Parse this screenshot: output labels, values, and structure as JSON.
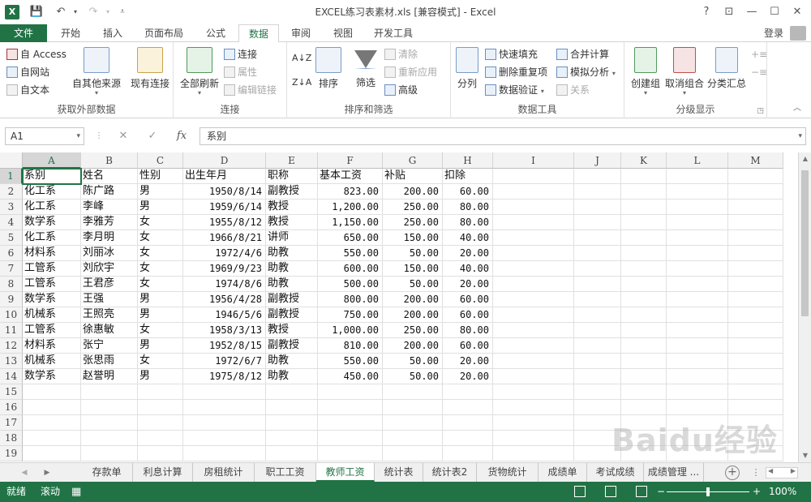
{
  "title_bar": {
    "title": "EXCEL练习表素材.xls  [兼容模式] - Excel",
    "logo": "X",
    "help": "?",
    "restore_ribbon": "⊡",
    "minimize": "—",
    "maximize": "☐",
    "close": "✕"
  },
  "tabs": {
    "items": [
      "文件",
      "开始",
      "插入",
      "页面布局",
      "公式",
      "数据",
      "审阅",
      "视图",
      "开发工具"
    ],
    "active": "数据",
    "login": "登录"
  },
  "ribbon": {
    "groups": {
      "external": "获取外部数据",
      "connections": "连接",
      "sortfilter": "排序和筛选",
      "datatools": "数据工具",
      "outline": "分级显示"
    },
    "buttons": {
      "from_access": "自 Access",
      "from_web": "自网站",
      "from_text": "自文本",
      "from_other": "自其他来源",
      "existing": "现有连接",
      "refresh_all": "全部刷新",
      "connections": "连接",
      "properties": "属性",
      "edit_links": "编辑链接",
      "sort": "排序",
      "filter": "筛选",
      "clear": "清除",
      "reapply": "重新应用",
      "advanced": "高级",
      "text_to_columns": "分列",
      "flash_fill": "快速填充",
      "remove_dup": "删除重复项",
      "validation": "数据验证",
      "consolidate": "合并计算",
      "whatif": "模拟分析",
      "relations": "关系",
      "group": "创建组",
      "ungroup": "取消组合",
      "subtotal": "分类汇总"
    }
  },
  "formula_bar": {
    "name_box": "A1",
    "cancel": "✕",
    "enter": "✓",
    "fx": "fx",
    "value": "系别"
  },
  "grid": {
    "columns": [
      "A",
      "B",
      "C",
      "D",
      "E",
      "F",
      "G",
      "H",
      "I",
      "J",
      "K",
      "L",
      "M"
    ],
    "row_numbers": [
      "1",
      "2",
      "3",
      "4",
      "5",
      "6",
      "7",
      "8",
      "9",
      "10",
      "11",
      "12",
      "13",
      "14",
      "15",
      "16",
      "17",
      "18",
      "19"
    ],
    "rows": [
      [
        "系别",
        "姓名",
        "性别",
        "出生年月",
        "职称",
        "基本工资",
        "补贴",
        "扣除"
      ],
      [
        "化工系",
        "陈广路",
        "男",
        "1950/8/14",
        "副教授",
        "823.00",
        "200.00",
        "60.00"
      ],
      [
        "化工系",
        "李峰",
        "男",
        "1959/6/14",
        "教授",
        "1,200.00",
        "250.00",
        "80.00"
      ],
      [
        "数学系",
        "李雅芳",
        "女",
        "1955/8/12",
        "教授",
        "1,150.00",
        "250.00",
        "80.00"
      ],
      [
        "化工系",
        "李月明",
        "女",
        "1966/8/21",
        "讲师",
        "650.00",
        "150.00",
        "40.00"
      ],
      [
        "材料系",
        "刘丽冰",
        "女",
        "1972/4/6",
        "助教",
        "550.00",
        "50.00",
        "20.00"
      ],
      [
        "工管系",
        "刘欣宇",
        "女",
        "1969/9/23",
        "助教",
        "600.00",
        "150.00",
        "40.00"
      ],
      [
        "工管系",
        "王君彦",
        "女",
        "1974/8/6",
        "助教",
        "500.00",
        "50.00",
        "20.00"
      ],
      [
        "数学系",
        "王强",
        "男",
        "1956/4/28",
        "副教授",
        "800.00",
        "200.00",
        "60.00"
      ],
      [
        "机械系",
        "王照亮",
        "男",
        "1946/5/6",
        "副教授",
        "750.00",
        "200.00",
        "60.00"
      ],
      [
        "工管系",
        "徐惠敏",
        "女",
        "1958/3/13",
        "教授",
        "1,000.00",
        "250.00",
        "80.00"
      ],
      [
        "材料系",
        "张宁",
        "男",
        "1952/8/15",
        "副教授",
        "810.00",
        "200.00",
        "60.00"
      ],
      [
        "机械系",
        "张思雨",
        "女",
        "1972/6/7",
        "助教",
        "550.00",
        "50.00",
        "20.00"
      ],
      [
        "数学系",
        "赵誉明",
        "男",
        "1975/8/12",
        "助教",
        "450.00",
        "50.00",
        "20.00"
      ]
    ],
    "active_cell": "A1"
  },
  "sheets": {
    "items": [
      "存款单",
      "利息计算",
      "房租统计",
      "职工工资",
      "教师工资",
      "统计表",
      "统计表2",
      "货物统计",
      "成绩单",
      "考试成绩",
      "成绩管理 ..."
    ],
    "active": "教师工资",
    "add": "+"
  },
  "status": {
    "ready": "就绪",
    "scroll": "滚动",
    "zoom_out": "−",
    "zoom_in": "+",
    "zoom": "100%",
    "zoom_level": 100
  },
  "watermark": "Baidu经验"
}
